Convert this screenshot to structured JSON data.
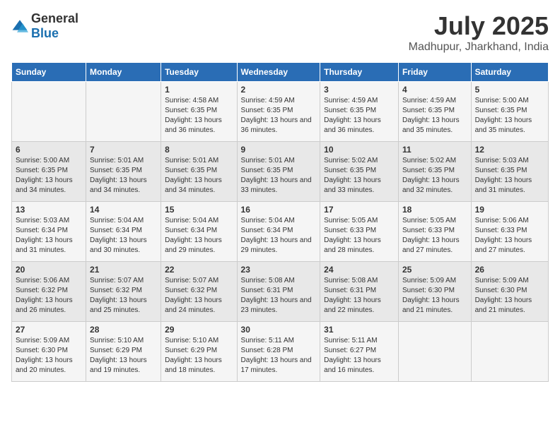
{
  "logo": {
    "general": "General",
    "blue": "Blue"
  },
  "title": "July 2025",
  "subtitle": "Madhupur, Jharkhand, India",
  "headers": [
    "Sunday",
    "Monday",
    "Tuesday",
    "Wednesday",
    "Thursday",
    "Friday",
    "Saturday"
  ],
  "weeks": [
    [
      {
        "day": "",
        "info": ""
      },
      {
        "day": "",
        "info": ""
      },
      {
        "day": "1",
        "info": "Sunrise: 4:58 AM\nSunset: 6:35 PM\nDaylight: 13 hours and 36 minutes."
      },
      {
        "day": "2",
        "info": "Sunrise: 4:59 AM\nSunset: 6:35 PM\nDaylight: 13 hours and 36 minutes."
      },
      {
        "day": "3",
        "info": "Sunrise: 4:59 AM\nSunset: 6:35 PM\nDaylight: 13 hours and 36 minutes."
      },
      {
        "day": "4",
        "info": "Sunrise: 4:59 AM\nSunset: 6:35 PM\nDaylight: 13 hours and 35 minutes."
      },
      {
        "day": "5",
        "info": "Sunrise: 5:00 AM\nSunset: 6:35 PM\nDaylight: 13 hours and 35 minutes."
      }
    ],
    [
      {
        "day": "6",
        "info": "Sunrise: 5:00 AM\nSunset: 6:35 PM\nDaylight: 13 hours and 34 minutes."
      },
      {
        "day": "7",
        "info": "Sunrise: 5:01 AM\nSunset: 6:35 PM\nDaylight: 13 hours and 34 minutes."
      },
      {
        "day": "8",
        "info": "Sunrise: 5:01 AM\nSunset: 6:35 PM\nDaylight: 13 hours and 34 minutes."
      },
      {
        "day": "9",
        "info": "Sunrise: 5:01 AM\nSunset: 6:35 PM\nDaylight: 13 hours and 33 minutes."
      },
      {
        "day": "10",
        "info": "Sunrise: 5:02 AM\nSunset: 6:35 PM\nDaylight: 13 hours and 33 minutes."
      },
      {
        "day": "11",
        "info": "Sunrise: 5:02 AM\nSunset: 6:35 PM\nDaylight: 13 hours and 32 minutes."
      },
      {
        "day": "12",
        "info": "Sunrise: 5:03 AM\nSunset: 6:35 PM\nDaylight: 13 hours and 31 minutes."
      }
    ],
    [
      {
        "day": "13",
        "info": "Sunrise: 5:03 AM\nSunset: 6:34 PM\nDaylight: 13 hours and 31 minutes."
      },
      {
        "day": "14",
        "info": "Sunrise: 5:04 AM\nSunset: 6:34 PM\nDaylight: 13 hours and 30 minutes."
      },
      {
        "day": "15",
        "info": "Sunrise: 5:04 AM\nSunset: 6:34 PM\nDaylight: 13 hours and 29 minutes."
      },
      {
        "day": "16",
        "info": "Sunrise: 5:04 AM\nSunset: 6:34 PM\nDaylight: 13 hours and 29 minutes."
      },
      {
        "day": "17",
        "info": "Sunrise: 5:05 AM\nSunset: 6:33 PM\nDaylight: 13 hours and 28 minutes."
      },
      {
        "day": "18",
        "info": "Sunrise: 5:05 AM\nSunset: 6:33 PM\nDaylight: 13 hours and 27 minutes."
      },
      {
        "day": "19",
        "info": "Sunrise: 5:06 AM\nSunset: 6:33 PM\nDaylight: 13 hours and 27 minutes."
      }
    ],
    [
      {
        "day": "20",
        "info": "Sunrise: 5:06 AM\nSunset: 6:32 PM\nDaylight: 13 hours and 26 minutes."
      },
      {
        "day": "21",
        "info": "Sunrise: 5:07 AM\nSunset: 6:32 PM\nDaylight: 13 hours and 25 minutes."
      },
      {
        "day": "22",
        "info": "Sunrise: 5:07 AM\nSunset: 6:32 PM\nDaylight: 13 hours and 24 minutes."
      },
      {
        "day": "23",
        "info": "Sunrise: 5:08 AM\nSunset: 6:31 PM\nDaylight: 13 hours and 23 minutes."
      },
      {
        "day": "24",
        "info": "Sunrise: 5:08 AM\nSunset: 6:31 PM\nDaylight: 13 hours and 22 minutes."
      },
      {
        "day": "25",
        "info": "Sunrise: 5:09 AM\nSunset: 6:30 PM\nDaylight: 13 hours and 21 minutes."
      },
      {
        "day": "26",
        "info": "Sunrise: 5:09 AM\nSunset: 6:30 PM\nDaylight: 13 hours and 21 minutes."
      }
    ],
    [
      {
        "day": "27",
        "info": "Sunrise: 5:09 AM\nSunset: 6:30 PM\nDaylight: 13 hours and 20 minutes."
      },
      {
        "day": "28",
        "info": "Sunrise: 5:10 AM\nSunset: 6:29 PM\nDaylight: 13 hours and 19 minutes."
      },
      {
        "day": "29",
        "info": "Sunrise: 5:10 AM\nSunset: 6:29 PM\nDaylight: 13 hours and 18 minutes."
      },
      {
        "day": "30",
        "info": "Sunrise: 5:11 AM\nSunset: 6:28 PM\nDaylight: 13 hours and 17 minutes."
      },
      {
        "day": "31",
        "info": "Sunrise: 5:11 AM\nSunset: 6:27 PM\nDaylight: 13 hours and 16 minutes."
      },
      {
        "day": "",
        "info": ""
      },
      {
        "day": "",
        "info": ""
      }
    ]
  ]
}
